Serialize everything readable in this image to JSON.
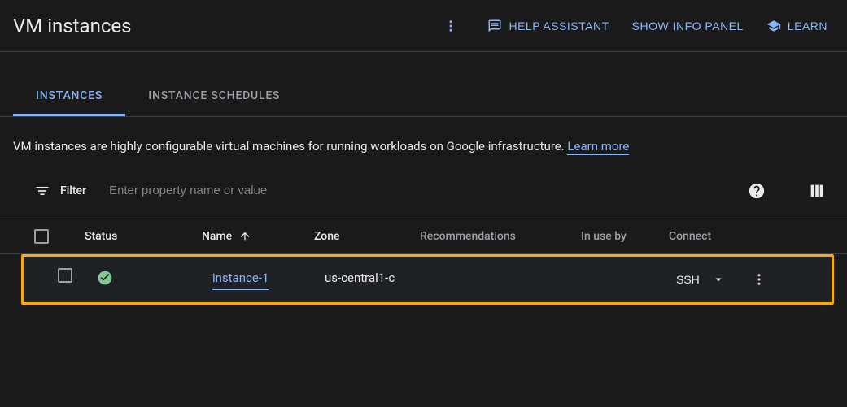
{
  "header": {
    "title": "VM instances",
    "help_assistant": "HELP ASSISTANT",
    "show_info_panel": "SHOW INFO PANEL",
    "learn": "LEARN"
  },
  "tabs": [
    {
      "label": "INSTANCES",
      "active": true
    },
    {
      "label": "INSTANCE SCHEDULES",
      "active": false
    }
  ],
  "description": {
    "text": "VM instances are highly configurable virtual machines for running workloads on Google infrastructure. ",
    "learn_more": "Learn more"
  },
  "filter": {
    "label": "Filter",
    "placeholder": "Enter property name or value"
  },
  "table": {
    "columns": {
      "status": "Status",
      "name": "Name",
      "zone": "Zone",
      "recommendations": "Recommendations",
      "in_use_by": "In use by",
      "connect": "Connect"
    },
    "rows": [
      {
        "status": "running",
        "name": "instance-1",
        "zone": "us-central1-c",
        "recommendations": "",
        "in_use_by": "",
        "connect": "SSH"
      }
    ]
  }
}
